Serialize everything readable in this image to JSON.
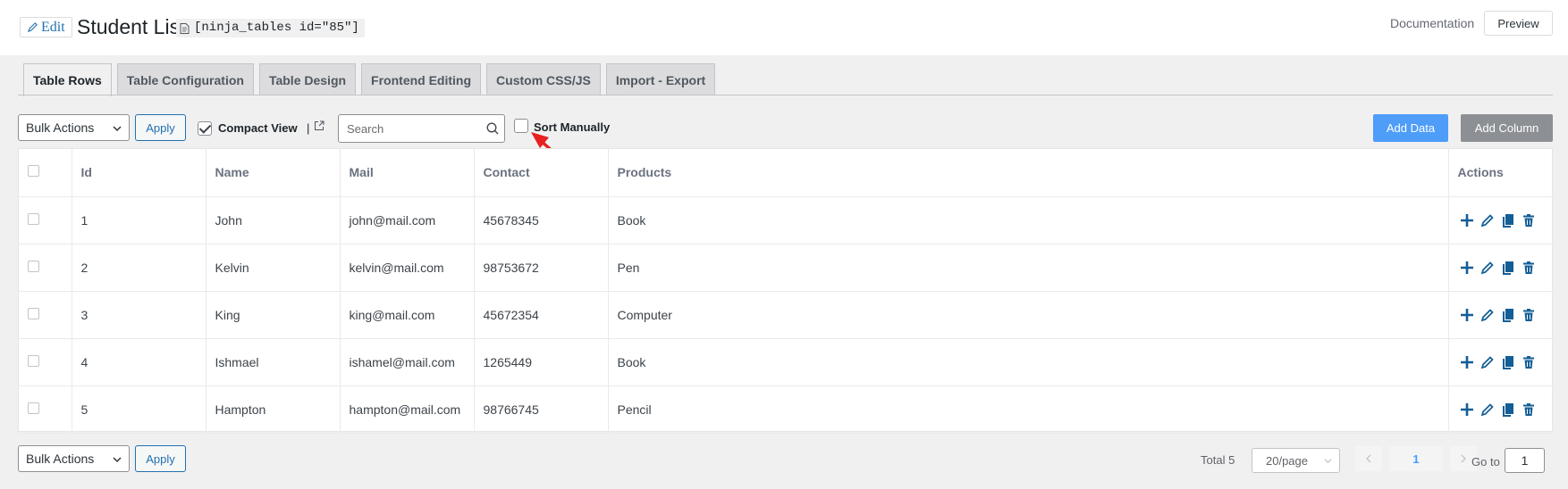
{
  "header": {
    "edit_label": "Edit",
    "title": "Student List",
    "shortcode": "[ninja_tables id=\"85\"]",
    "documentation_label": "Documentation",
    "preview_label": "Preview"
  },
  "tabs": [
    {
      "label": "Table Rows",
      "active": true
    },
    {
      "label": "Table Configuration",
      "active": false
    },
    {
      "label": "Table Design",
      "active": false
    },
    {
      "label": "Frontend Editing",
      "active": false
    },
    {
      "label": "Custom CSS/JS",
      "active": false
    },
    {
      "label": "Import - Export",
      "active": false
    }
  ],
  "toolbar": {
    "bulk_actions": "Bulk Actions",
    "apply_label": "Apply",
    "compact_view_label": "Compact View",
    "compact_view_checked": true,
    "compact_sep": "|",
    "search_placeholder": "Search",
    "sort_manually_label": "Sort Manually",
    "sort_manually_checked": false,
    "add_data_label": "Add Data",
    "add_column_label": "Add Column"
  },
  "table": {
    "columns": [
      "Id",
      "Name",
      "Mail",
      "Contact",
      "Products",
      "Actions"
    ],
    "rows": [
      {
        "id": "1",
        "name": "John",
        "mail": "john@mail.com",
        "contact": "45678345",
        "product": "Book"
      },
      {
        "id": "2",
        "name": "Kelvin",
        "mail": "kelvin@mail.com",
        "contact": "98753672",
        "product": "Pen"
      },
      {
        "id": "3",
        "name": "King",
        "mail": "king@mail.com",
        "contact": "45672354",
        "product": "Computer"
      },
      {
        "id": "4",
        "name": "Ishmael",
        "mail": "ishamel@mail.com",
        "contact": "1265449",
        "product": "Book"
      },
      {
        "id": "5",
        "name": "Hampton",
        "mail": "hampton@mail.com",
        "contact": "98766745",
        "product": "Pencil"
      }
    ]
  },
  "footer": {
    "bulk_actions": "Bulk Actions",
    "apply_label": "Apply",
    "total_label": "Total 5",
    "page_size": "20/page",
    "current_page": "1",
    "goto_label": "Go to",
    "goto_value": "1"
  },
  "colors": {
    "accent": "#2271b1",
    "add_data_bg": "#4d9df9",
    "add_column_bg": "#8c8f94",
    "annotation_arrow": "#e8201f",
    "action_icon": "#135e96"
  },
  "icons": [
    "pencil-icon",
    "document-icon",
    "external-link-icon",
    "search-icon",
    "plus-icon",
    "edit-icon",
    "copy-icon",
    "trash-icon",
    "chevron-down-icon",
    "chevron-left-icon",
    "chevron-right-icon"
  ]
}
